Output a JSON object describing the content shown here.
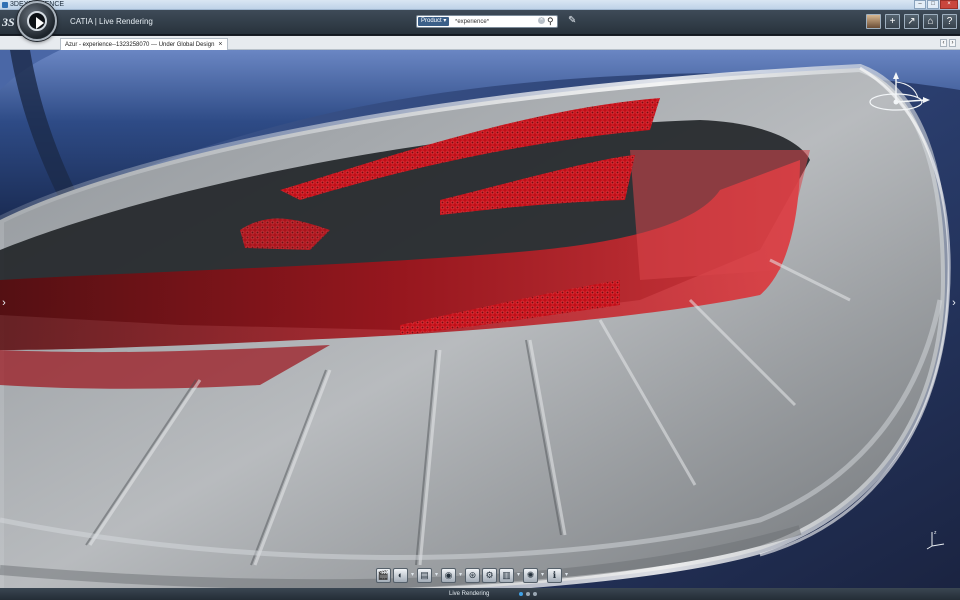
{
  "os_window": {
    "title": "3DEXPERIENCE",
    "controls": [
      "minimize",
      "maximize",
      "close"
    ]
  },
  "header": {
    "logo_text": "3S",
    "app_name": "CATIA | Live Rendering",
    "search": {
      "scope": "Product",
      "value": "*experience*"
    },
    "right_icons": [
      "user-avatar-icon",
      "add-icon",
      "share-icon",
      "home-icon",
      "help-icon"
    ],
    "right_glyphs": [
      "",
      "+",
      "↗",
      "⌂",
      "?"
    ]
  },
  "document_tab": {
    "label": "Azur - experience--1323258070 --- Under Global Design",
    "close_glyph": "×"
  },
  "tab_nav": {
    "prev": "‹",
    "next": "›"
  },
  "viewport": {
    "scene": "Car tail-light close-up",
    "body_color": "#2e4b86",
    "light_color": "#d8141a",
    "left_arrow": "›",
    "right_arrow": "›"
  },
  "action_bar": {
    "icons": [
      "clapperboard-icon",
      "material-sphere-icon",
      "environment-icon",
      "camera-icon",
      "render-settings-icon",
      "gear-icon",
      "scene-layers-icon",
      "light-sources-icon",
      "info-icon"
    ],
    "glyphs": [
      "🎬",
      "◐",
      "▤",
      "◉",
      "⊛",
      "⚙",
      "▥",
      "✺",
      "ℹ"
    ]
  },
  "section_bar": {
    "label": "Live Rendering",
    "dots": 3,
    "active_dot": 0
  }
}
